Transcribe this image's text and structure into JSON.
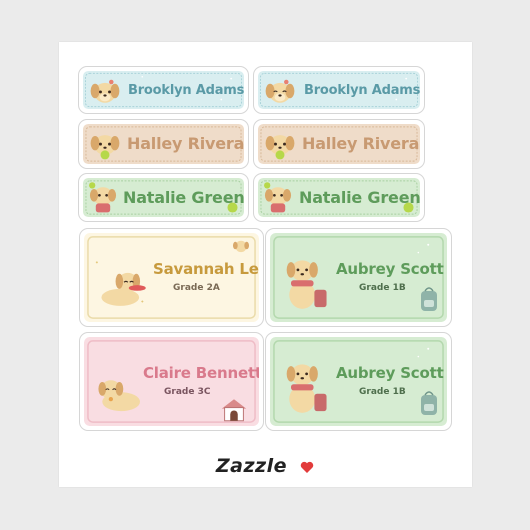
{
  "labels": {
    "row1_left": {
      "name": "Brooklyn Adams"
    },
    "row1_right": {
      "name": "Brooklyn Adams"
    },
    "row2_left": {
      "name": "Halley Rivera"
    },
    "row2_right": {
      "name": "Halley Rivera"
    },
    "row3_left": {
      "name": "Natalie Green"
    },
    "row3_right": {
      "name": "Natalie Green"
    },
    "big1": {
      "name": "Savannah Lee",
      "grade": "Grade 2A"
    },
    "big2": {
      "name": "Aubrey Scott",
      "grade": "Grade 1B"
    },
    "big3": {
      "name": "Claire Bennett",
      "grade": "Grade 3C"
    },
    "big4": {
      "name": "Aubrey Scott",
      "grade": "Grade 1B"
    }
  },
  "brand": {
    "name": "Zazzle"
  },
  "colors": {
    "blue_bg": "#d9eef0",
    "blue_text": "#5a9aa6",
    "tan_bg": "#efdcc9",
    "tan_text": "#c89a72",
    "green_bg": "#d6ecd2",
    "green_text": "#5e9c5b",
    "cream_bg": "#fdf6e2",
    "cream_text": "#c79a3d",
    "pink_bg": "#f9dde2",
    "pink_text": "#d97a8c",
    "heart": "#e23b3b"
  },
  "icons": [
    "puppy-icon",
    "dog-house-icon",
    "backpack-icon",
    "tennis-ball-icon",
    "frisbee-icon",
    "heart-icon"
  ]
}
